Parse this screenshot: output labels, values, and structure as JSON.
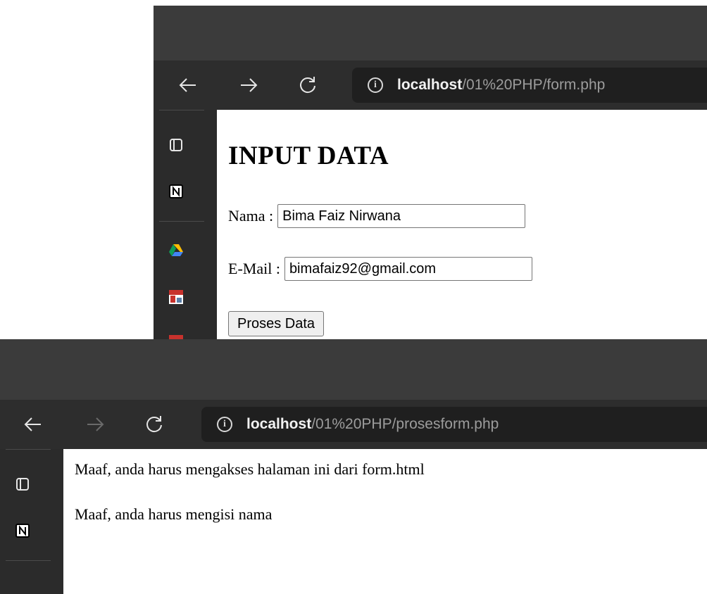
{
  "form_page": {
    "address": {
      "host": "localhost",
      "path": "/01%20PHP/form.php"
    },
    "heading": "INPUT DATA",
    "name_label": "Nama :",
    "name_value": "Bima Faiz Nirwana",
    "email_label": "E-Mail :",
    "email_value": "bimafaiz92@gmail.com",
    "submit_label": "Proses Data"
  },
  "result_page": {
    "address": {
      "host": "localhost",
      "path": "/01%20PHP/prosesform.php"
    },
    "messages": [
      "Maaf, anda harus mengakses halaman ini dari form.html",
      "Maaf, anda harus mengisi nama"
    ]
  },
  "icons": {
    "back": "back-arrow-icon",
    "forward": "forward-arrow-icon",
    "reload": "reload-icon",
    "site_info": "info-icon",
    "tabs": "tab-actions-icon",
    "notion": "notion-icon",
    "drive": "google-drive-icon",
    "app": "app-shortcut-icon"
  },
  "colors": {
    "toolbar": "#2d2d2d",
    "titlebar": "#3b3b3b",
    "address_bg": "#1f1f1f",
    "sidebar": "#2b2b2b"
  }
}
